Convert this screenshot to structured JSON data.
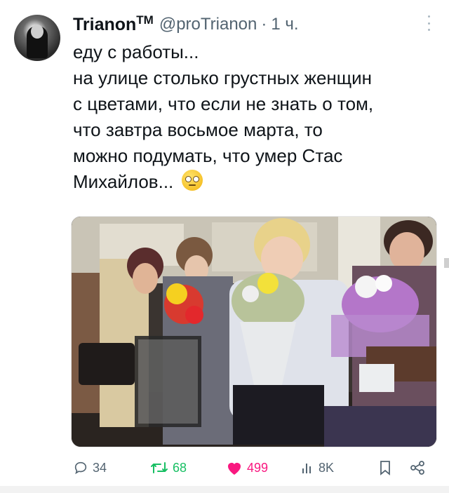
{
  "tweet": {
    "author_name": "Trianon",
    "trademark": "TM",
    "handle": "@proTrianon",
    "separator": "·",
    "time": "1 ч.",
    "lines": [
      "еду с работы...",
      "на улице столько грустных женщин",
      "с цветами, что если не знать о том,",
      "что завтра восьмое марта, то",
      "можно подумать, что умер Стас",
      "Михайлов..."
    ],
    "emoji": "face-with-rolling-eyes"
  },
  "actions": {
    "replies": "34",
    "retweets": "68",
    "likes": "499",
    "views": "8K",
    "icons": [
      "reply-icon",
      "retweet-icon",
      "heart-icon",
      "views-icon",
      "bookmark-icon",
      "share-icon"
    ]
  },
  "colors": {
    "text": "#0f1419",
    "muted": "#536471",
    "retweet": "#17bf63",
    "like": "#f91880"
  }
}
